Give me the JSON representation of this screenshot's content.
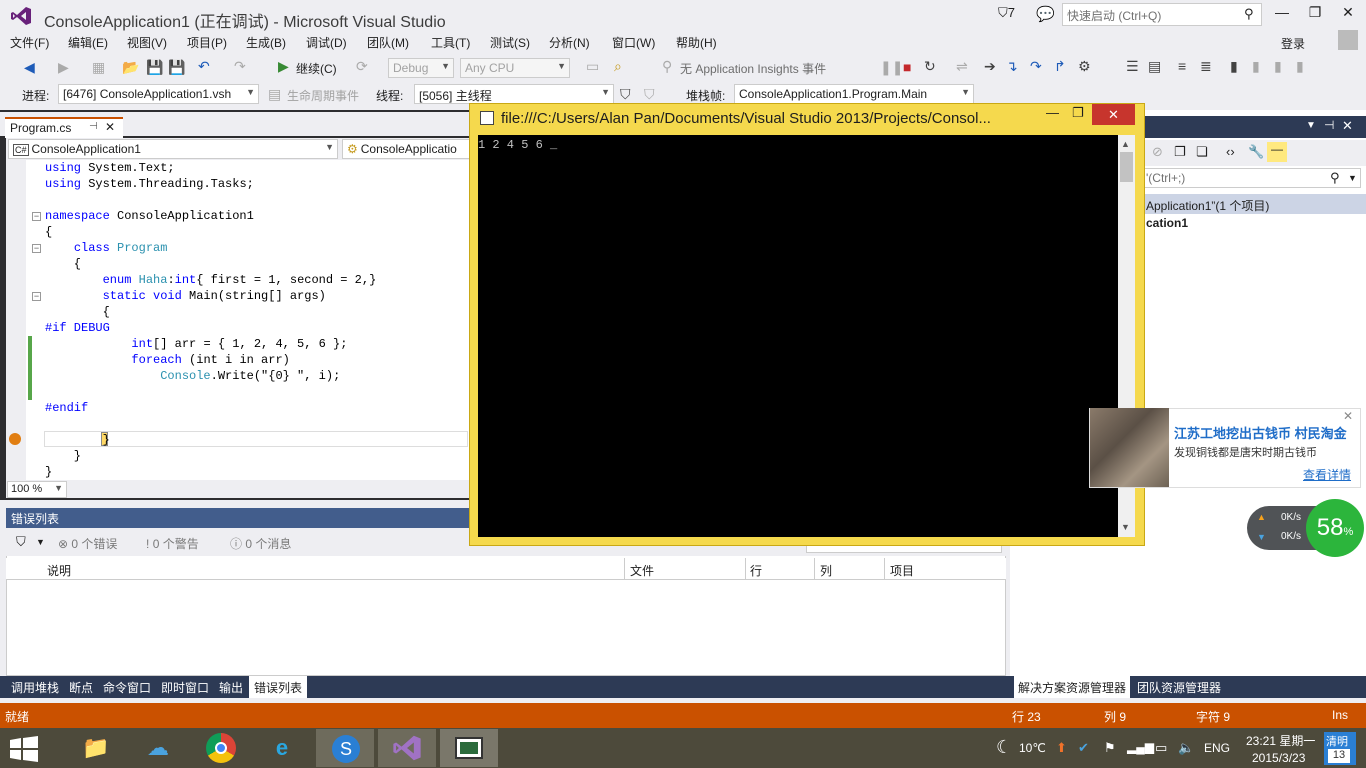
{
  "window": {
    "title": "ConsoleApplication1 (正在调试) - Microsoft Visual Studio",
    "notification_count": "7",
    "quick_launch_placeholder": "快速启动 (Ctrl+Q)",
    "login": "登录"
  },
  "menu": [
    "文件(F)",
    "编辑(E)",
    "视图(V)",
    "项目(P)",
    "生成(B)",
    "调试(D)",
    "团队(M)",
    "工具(T)",
    "测试(S)",
    "分析(N)",
    "窗口(W)",
    "帮助(H)"
  ],
  "toolbar": {
    "continue_label": "继续(C)",
    "config": "Debug",
    "platform": "Any CPU",
    "insights": "无 Application Insights 事件"
  },
  "debug_location": {
    "process_label": "进程:",
    "process": "[6476] ConsoleApplication1.vsh",
    "lifecycle": "生命周期事件",
    "thread_label": "线程:",
    "thread": "[5056] 主线程",
    "stackframe_label": "堆栈帧:",
    "stackframe": "ConsoleApplication1.Program.Main"
  },
  "editor": {
    "tab_name": "Program.cs",
    "nav_left": "ConsoleApplication1",
    "nav_right": "ConsoleApplicatio",
    "zoom": "100 %",
    "lines": [
      "using System.Text;",
      "using System.Threading.Tasks;",
      "",
      "namespace ConsoleApplication1",
      "{",
      "    class Program",
      "    {",
      "        enum Haha:int{ first = 1, second = 2,}",
      "        static void Main(string[] args)",
      "        {",
      "#if DEBUG",
      "            int[] arr = { 1, 2, 4, 5, 6 };",
      "            foreach (int i in arr)",
      "                Console.Write(\"{0} \", i);",
      "",
      "#endif",
      "",
      "        }",
      "    }",
      "}"
    ]
  },
  "console": {
    "title": "file:///C:/Users/Alan Pan/Documents/Visual Studio 2013/Projects/Consol...",
    "output": "1 2 4 5 6 _"
  },
  "error_list": {
    "title": "错误列表",
    "errors": "0 个错误",
    "warnings": "0 个警告",
    "messages": "0 个消息",
    "columns": [
      "说明",
      "文件",
      "行",
      "列",
      "项目"
    ]
  },
  "bottom_tabs": [
    "调用堆栈",
    "断点",
    "命令窗口",
    "即时窗口",
    "输出",
    "错误列表"
  ],
  "solution": {
    "search_hint": "'(Ctrl+;)",
    "solution_line": "Application1”(1 个项目)",
    "project_line": "cation1",
    "tabs": [
      "解决方案资源管理器",
      "团队资源管理器"
    ]
  },
  "news": {
    "title": "江苏工地挖出古钱币 村民淘金",
    "subtitle": "发现铜钱都是唐宋时期古钱币",
    "more": "查看详情"
  },
  "speed": {
    "up": "0K/s",
    "down": "0K/s",
    "percent": "58",
    "unit": "%"
  },
  "status": {
    "ready": "就绪",
    "line": "行 23",
    "col": "列 9",
    "char": "字符 9",
    "mode": "Ins"
  },
  "tray": {
    "temperature": "10℃",
    "lang": "ENG",
    "time": "23:21 星期一",
    "date": "2015/3/23",
    "calendar_top": "清明",
    "calendar_day": "13"
  }
}
